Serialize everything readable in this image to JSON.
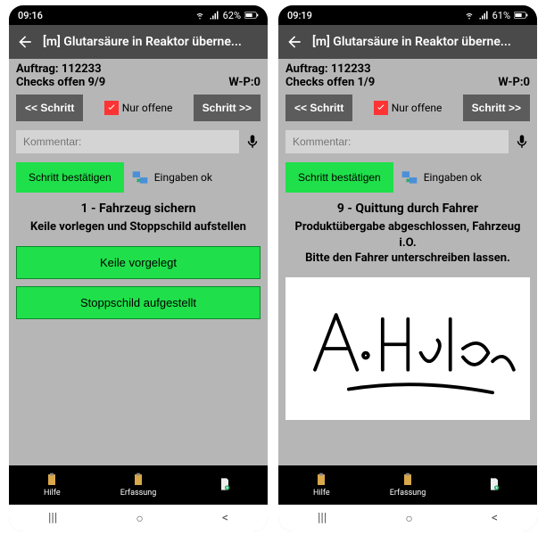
{
  "screens": [
    {
      "status": {
        "time": "09:16",
        "battery": "62%"
      },
      "header": {
        "title": "[m] Glutarsäure in Reaktor überne..."
      },
      "info": {
        "auftrag_label": "Auftrag:",
        "auftrag_value": "112233",
        "checks": "Checks offen 9/9",
        "wp": "W-P:0"
      },
      "nav": {
        "prev": "<< Schritt",
        "only_open": "Nur offene",
        "next": "Schritt >>"
      },
      "comment": {
        "placeholder": "Kommentar:"
      },
      "confirm": {
        "button": "Schritt bestätigen",
        "eingaben": "Eingaben ok"
      },
      "step": {
        "title": "1 - Fahrzeug sichern",
        "desc": "Keile vorlegen und Stoppschild aufstellen"
      },
      "tasks": [
        "Keile vorgelegt",
        "Stoppschild aufgestellt"
      ],
      "tabs": {
        "hilfe": "Hilfe",
        "erfassung": "Erfassung",
        "doc": ""
      }
    },
    {
      "status": {
        "time": "09:19",
        "battery": "61%"
      },
      "header": {
        "title": "[m] Glutarsäure in Reaktor überne..."
      },
      "info": {
        "auftrag_label": "Auftrag:",
        "auftrag_value": "112233",
        "checks": "Checks offen 1/9",
        "wp": "W-P:0"
      },
      "nav": {
        "prev": "<< Schritt",
        "only_open": "Nur offene",
        "next": "Schritt >>"
      },
      "comment": {
        "placeholder": "Kommentar:"
      },
      "confirm": {
        "button": "Schritt bestätigen",
        "eingaben": "Eingaben ok"
      },
      "step": {
        "title": "9 - Quittung durch Fahrer",
        "desc": "Produktübergabe abgeschlossen, Fahrzeug i.O.\nBitte den Fahrer unterschreiben lassen."
      },
      "signature_name": "A. Huber",
      "tabs": {
        "hilfe": "Hilfe",
        "erfassung": "Erfassung",
        "doc": ""
      }
    }
  ]
}
